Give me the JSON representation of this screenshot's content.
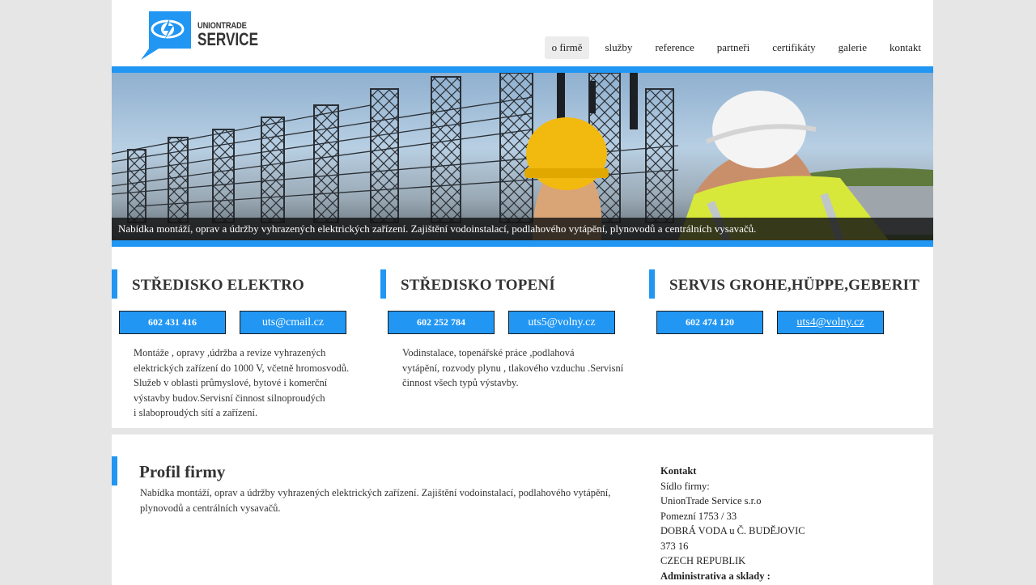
{
  "logo": {
    "line1": "UNIONTRADE",
    "line2": "SERVICE"
  },
  "nav": [
    {
      "label": "o firmě",
      "active": true
    },
    {
      "label": "služby"
    },
    {
      "label": "reference"
    },
    {
      "label": "partneři"
    },
    {
      "label": "certifikáty"
    },
    {
      "label": "galerie"
    },
    {
      "label": "kontakt"
    }
  ],
  "banner": {
    "caption": "Nabídka montáží, oprav a údržby vyhrazených elektrických zařízení. Zajištění vodoinstalací, podlahového vytápění, plynovodů a centrálních vysavačů."
  },
  "services": [
    {
      "title": "STŘEDISKO ELEKTRO",
      "phone": "602 431 416",
      "email": "uts@cmail.cz",
      "text": "Montáže , opravy ,údržba a revize vyhrazených\nelektrických zařízení do 1000 V, včetně hromosvodů.\nSlužeb v oblasti průmyslové, bytové i komerční\nvýstavby budov.Servisní činnost silnoproudých\ni slaboproudých sítí a zařízení."
    },
    {
      "title": "STŘEDISKO TOPENÍ",
      "phone": "602 252 784",
      "email": "uts5@volny.cz",
      "text": "Vodinstalace, topenářské práce ,podlahová\n vytápění, rozvody plynu , tlakového  vzduchu .Servisní\nčinnost všech typů výstavby."
    },
    {
      "title": "SERVIS GROHE,HÜPPE,GEBERIT",
      "phone": "602 474 120",
      "email": "uts4@volny.cz",
      "text": ""
    }
  ],
  "profile": {
    "title": "Profil firmy",
    "text": "Nabídka montáží, oprav a údržby vyhrazených elektrických zařízení. Zajištění vodoinstalací, podlahového vytápění, plynovodů a centrálních vysavačů."
  },
  "contact": {
    "heading": "Kontakt",
    "lines": [
      "Sídlo firmy:",
      "UnionTrade Service s.r.o",
      "Pomezní 1753 / 33",
      "DOBRÁ  VODA u Č. BUDĚJOVIC",
      "373  16",
      "CZECH   REPUBLIK"
    ],
    "footer_heading": "Administrativa a sklady :"
  },
  "colors": {
    "accent": "#2196f3",
    "background": "#e6e6e6"
  }
}
